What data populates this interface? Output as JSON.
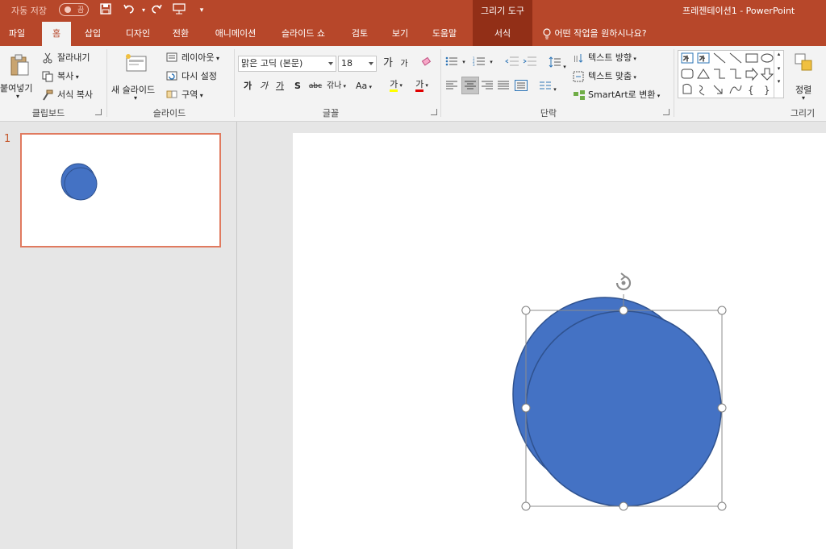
{
  "titlebar": {
    "autosave_label": "자동 저장",
    "autosave_state": "끔",
    "context_group": "그리기 도구",
    "document_title": "프레젠테이션1  -  PowerPoint"
  },
  "tabs": [
    {
      "label": "파일"
    },
    {
      "label": "홈"
    },
    {
      "label": "삽입"
    },
    {
      "label": "디자인"
    },
    {
      "label": "전환"
    },
    {
      "label": "애니메이션"
    },
    {
      "label": "슬라이드 쇼"
    },
    {
      "label": "검토"
    },
    {
      "label": "보기"
    },
    {
      "label": "도움말"
    },
    {
      "label": "서식"
    }
  ],
  "tellme": "어떤 작업을 원하시나요?",
  "clipboard": {
    "paste": "붙여넣기",
    "cut": "잘라내기",
    "copy": "복사",
    "format_painter": "서식 복사",
    "group": "클립보드"
  },
  "slides_group": {
    "new_slide": "새 슬라이드",
    "layout": "레이아웃",
    "reset": "다시 설정",
    "section": "구역",
    "group": "슬라이드"
  },
  "font": {
    "name": "맑은 고딕 (본문)",
    "size": "18",
    "grow": "가",
    "shrink": "가",
    "bold": "가",
    "italic": "가",
    "underline": "가",
    "shadow": "S",
    "strike": "abc",
    "spacing": "갂나",
    "case": "Aa",
    "highlight": "가",
    "color": "가",
    "group": "글꼴"
  },
  "paragraph": {
    "text_direction": "텍스트 방향",
    "align_text": "텍스트 맞춤",
    "smartart": "SmartArt로 변환",
    "group": "단락"
  },
  "drawing": {
    "arrange": "정렬",
    "group": "그리기"
  },
  "thumbnail": {
    "slide_number": "1"
  },
  "colors": {
    "accent": "#b7472a",
    "accent_dark": "#922f17",
    "shape_fill": "#4472c4",
    "shape_stroke": "#2f528f",
    "thumb_border": "#e07a5f"
  }
}
